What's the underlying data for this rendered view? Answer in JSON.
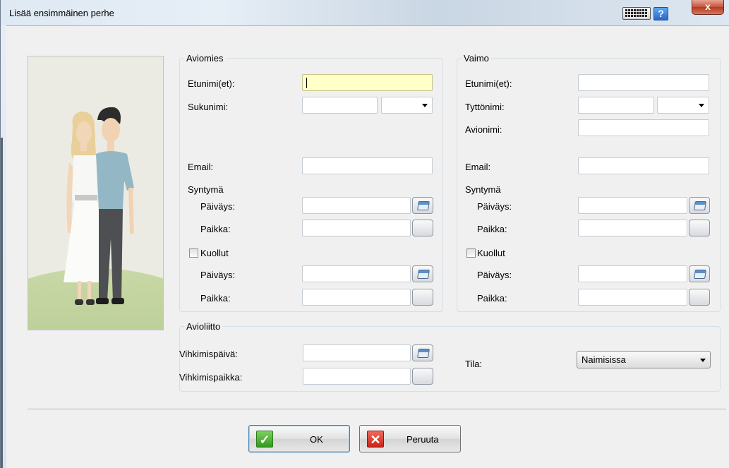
{
  "window": {
    "title": "Lisää ensimmäinen perhe",
    "help_label": "?",
    "close_label": "x"
  },
  "husband": {
    "legend": "Aviomies",
    "first_name_label": "Etunimi(et):",
    "last_name_label": "Sukunimi:",
    "email_label": "Email:",
    "birth_label": "Syntymä",
    "birth_date_label": "Päiväys:",
    "birth_place_label": "Paikka:",
    "deceased_label": "Kuollut",
    "death_date_label": "Päiväys:",
    "death_place_label": "Paikka:",
    "first_name_value": "",
    "last_name_value": "",
    "email_value": ""
  },
  "wife": {
    "legend": "Vaimo",
    "first_name_label": "Etunimi(et):",
    "maiden_name_label": "Tyttönimi:",
    "married_name_label": "Avionimi:",
    "email_label": "Email:",
    "birth_label": "Syntymä",
    "birth_date_label": "Päiväys:",
    "birth_place_label": "Paikka:",
    "deceased_label": "Kuollut",
    "death_date_label": "Päiväys:",
    "death_place_label": "Paikka:"
  },
  "marriage": {
    "legend": "Avioliitto",
    "date_label": "Vihkimispäivä:",
    "place_label": "Vihkimispaikka:",
    "status_label": "Tila:",
    "status_value": "Naimisissa"
  },
  "buttons": {
    "ok_label": "OK",
    "cancel_label": "Peruuta"
  },
  "colors": {
    "active_field": "#ffffc8",
    "ok_icon": "#2f9a1d",
    "cancel_icon": "#c9241a",
    "help_icon": "#2968c7"
  }
}
